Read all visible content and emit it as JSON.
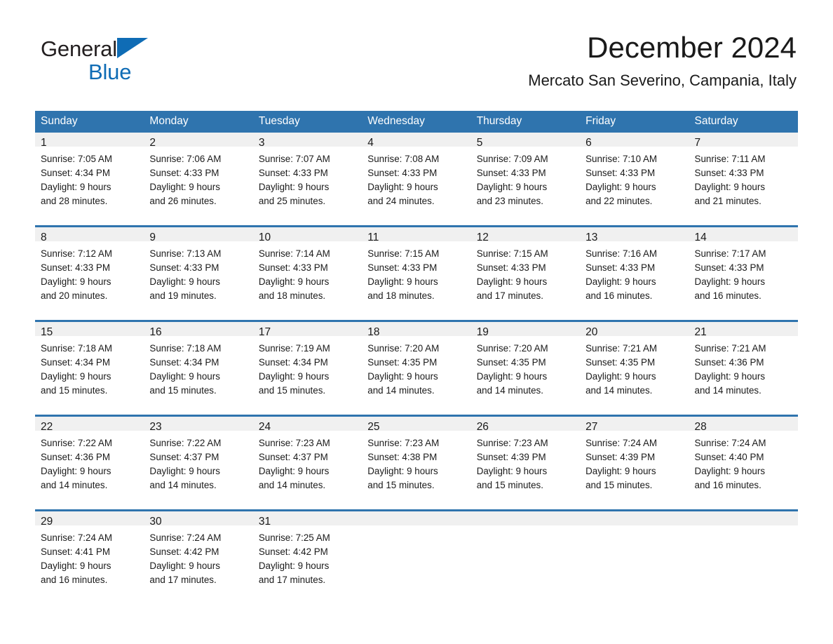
{
  "brand": {
    "name_part1": "General",
    "name_part2": "Blue",
    "triangle_icon": "brand-triangle-icon",
    "color": "#0f6cb5"
  },
  "header": {
    "title": "December 2024",
    "subtitle": "Mercato San Severino, Campania, Italy"
  },
  "theme": {
    "header_blue": "#2f74ae",
    "daynum_band": "#f0f0f0",
    "text": "#1a1a1a"
  },
  "weekday_headers": [
    "Sunday",
    "Monday",
    "Tuesday",
    "Wednesday",
    "Thursday",
    "Friday",
    "Saturday"
  ],
  "weeks": [
    {
      "days": [
        {
          "num": "1",
          "sunrise": "Sunrise: 7:05 AM",
          "sunset": "Sunset: 4:34 PM",
          "daylight_line1": "Daylight: 9 hours",
          "daylight_line2": "and 28 minutes."
        },
        {
          "num": "2",
          "sunrise": "Sunrise: 7:06 AM",
          "sunset": "Sunset: 4:33 PM",
          "daylight_line1": "Daylight: 9 hours",
          "daylight_line2": "and 26 minutes."
        },
        {
          "num": "3",
          "sunrise": "Sunrise: 7:07 AM",
          "sunset": "Sunset: 4:33 PM",
          "daylight_line1": "Daylight: 9 hours",
          "daylight_line2": "and 25 minutes."
        },
        {
          "num": "4",
          "sunrise": "Sunrise: 7:08 AM",
          "sunset": "Sunset: 4:33 PM",
          "daylight_line1": "Daylight: 9 hours",
          "daylight_line2": "and 24 minutes."
        },
        {
          "num": "5",
          "sunrise": "Sunrise: 7:09 AM",
          "sunset": "Sunset: 4:33 PM",
          "daylight_line1": "Daylight: 9 hours",
          "daylight_line2": "and 23 minutes."
        },
        {
          "num": "6",
          "sunrise": "Sunrise: 7:10 AM",
          "sunset": "Sunset: 4:33 PM",
          "daylight_line1": "Daylight: 9 hours",
          "daylight_line2": "and 22 minutes."
        },
        {
          "num": "7",
          "sunrise": "Sunrise: 7:11 AM",
          "sunset": "Sunset: 4:33 PM",
          "daylight_line1": "Daylight: 9 hours",
          "daylight_line2": "and 21 minutes."
        }
      ]
    },
    {
      "days": [
        {
          "num": "8",
          "sunrise": "Sunrise: 7:12 AM",
          "sunset": "Sunset: 4:33 PM",
          "daylight_line1": "Daylight: 9 hours",
          "daylight_line2": "and 20 minutes."
        },
        {
          "num": "9",
          "sunrise": "Sunrise: 7:13 AM",
          "sunset": "Sunset: 4:33 PM",
          "daylight_line1": "Daylight: 9 hours",
          "daylight_line2": "and 19 minutes."
        },
        {
          "num": "10",
          "sunrise": "Sunrise: 7:14 AM",
          "sunset": "Sunset: 4:33 PM",
          "daylight_line1": "Daylight: 9 hours",
          "daylight_line2": "and 18 minutes."
        },
        {
          "num": "11",
          "sunrise": "Sunrise: 7:15 AM",
          "sunset": "Sunset: 4:33 PM",
          "daylight_line1": "Daylight: 9 hours",
          "daylight_line2": "and 18 minutes."
        },
        {
          "num": "12",
          "sunrise": "Sunrise: 7:15 AM",
          "sunset": "Sunset: 4:33 PM",
          "daylight_line1": "Daylight: 9 hours",
          "daylight_line2": "and 17 minutes."
        },
        {
          "num": "13",
          "sunrise": "Sunrise: 7:16 AM",
          "sunset": "Sunset: 4:33 PM",
          "daylight_line1": "Daylight: 9 hours",
          "daylight_line2": "and 16 minutes."
        },
        {
          "num": "14",
          "sunrise": "Sunrise: 7:17 AM",
          "sunset": "Sunset: 4:33 PM",
          "daylight_line1": "Daylight: 9 hours",
          "daylight_line2": "and 16 minutes."
        }
      ]
    },
    {
      "days": [
        {
          "num": "15",
          "sunrise": "Sunrise: 7:18 AM",
          "sunset": "Sunset: 4:34 PM",
          "daylight_line1": "Daylight: 9 hours",
          "daylight_line2": "and 15 minutes."
        },
        {
          "num": "16",
          "sunrise": "Sunrise: 7:18 AM",
          "sunset": "Sunset: 4:34 PM",
          "daylight_line1": "Daylight: 9 hours",
          "daylight_line2": "and 15 minutes."
        },
        {
          "num": "17",
          "sunrise": "Sunrise: 7:19 AM",
          "sunset": "Sunset: 4:34 PM",
          "daylight_line1": "Daylight: 9 hours",
          "daylight_line2": "and 15 minutes."
        },
        {
          "num": "18",
          "sunrise": "Sunrise: 7:20 AM",
          "sunset": "Sunset: 4:35 PM",
          "daylight_line1": "Daylight: 9 hours",
          "daylight_line2": "and 14 minutes."
        },
        {
          "num": "19",
          "sunrise": "Sunrise: 7:20 AM",
          "sunset": "Sunset: 4:35 PM",
          "daylight_line1": "Daylight: 9 hours",
          "daylight_line2": "and 14 minutes."
        },
        {
          "num": "20",
          "sunrise": "Sunrise: 7:21 AM",
          "sunset": "Sunset: 4:35 PM",
          "daylight_line1": "Daylight: 9 hours",
          "daylight_line2": "and 14 minutes."
        },
        {
          "num": "21",
          "sunrise": "Sunrise: 7:21 AM",
          "sunset": "Sunset: 4:36 PM",
          "daylight_line1": "Daylight: 9 hours",
          "daylight_line2": "and 14 minutes."
        }
      ]
    },
    {
      "days": [
        {
          "num": "22",
          "sunrise": "Sunrise: 7:22 AM",
          "sunset": "Sunset: 4:36 PM",
          "daylight_line1": "Daylight: 9 hours",
          "daylight_line2": "and 14 minutes."
        },
        {
          "num": "23",
          "sunrise": "Sunrise: 7:22 AM",
          "sunset": "Sunset: 4:37 PM",
          "daylight_line1": "Daylight: 9 hours",
          "daylight_line2": "and 14 minutes."
        },
        {
          "num": "24",
          "sunrise": "Sunrise: 7:23 AM",
          "sunset": "Sunset: 4:37 PM",
          "daylight_line1": "Daylight: 9 hours",
          "daylight_line2": "and 14 minutes."
        },
        {
          "num": "25",
          "sunrise": "Sunrise: 7:23 AM",
          "sunset": "Sunset: 4:38 PM",
          "daylight_line1": "Daylight: 9 hours",
          "daylight_line2": "and 15 minutes."
        },
        {
          "num": "26",
          "sunrise": "Sunrise: 7:23 AM",
          "sunset": "Sunset: 4:39 PM",
          "daylight_line1": "Daylight: 9 hours",
          "daylight_line2": "and 15 minutes."
        },
        {
          "num": "27",
          "sunrise": "Sunrise: 7:24 AM",
          "sunset": "Sunset: 4:39 PM",
          "daylight_line1": "Daylight: 9 hours",
          "daylight_line2": "and 15 minutes."
        },
        {
          "num": "28",
          "sunrise": "Sunrise: 7:24 AM",
          "sunset": "Sunset: 4:40 PM",
          "daylight_line1": "Daylight: 9 hours",
          "daylight_line2": "and 16 minutes."
        }
      ]
    },
    {
      "days": [
        {
          "num": "29",
          "sunrise": "Sunrise: 7:24 AM",
          "sunset": "Sunset: 4:41 PM",
          "daylight_line1": "Daylight: 9 hours",
          "daylight_line2": "and 16 minutes."
        },
        {
          "num": "30",
          "sunrise": "Sunrise: 7:24 AM",
          "sunset": "Sunset: 4:42 PM",
          "daylight_line1": "Daylight: 9 hours",
          "daylight_line2": "and 17 minutes."
        },
        {
          "num": "31",
          "sunrise": "Sunrise: 7:25 AM",
          "sunset": "Sunset: 4:42 PM",
          "daylight_line1": "Daylight: 9 hours",
          "daylight_line2": "and 17 minutes."
        },
        {
          "num": "",
          "sunrise": "",
          "sunset": "",
          "daylight_line1": "",
          "daylight_line2": "",
          "blank": true
        },
        {
          "num": "",
          "sunrise": "",
          "sunset": "",
          "daylight_line1": "",
          "daylight_line2": "",
          "blank": true
        },
        {
          "num": "",
          "sunrise": "",
          "sunset": "",
          "daylight_line1": "",
          "daylight_line2": "",
          "blank": true
        },
        {
          "num": "",
          "sunrise": "",
          "sunset": "",
          "daylight_line1": "",
          "daylight_line2": "",
          "blank": true
        }
      ]
    }
  ]
}
